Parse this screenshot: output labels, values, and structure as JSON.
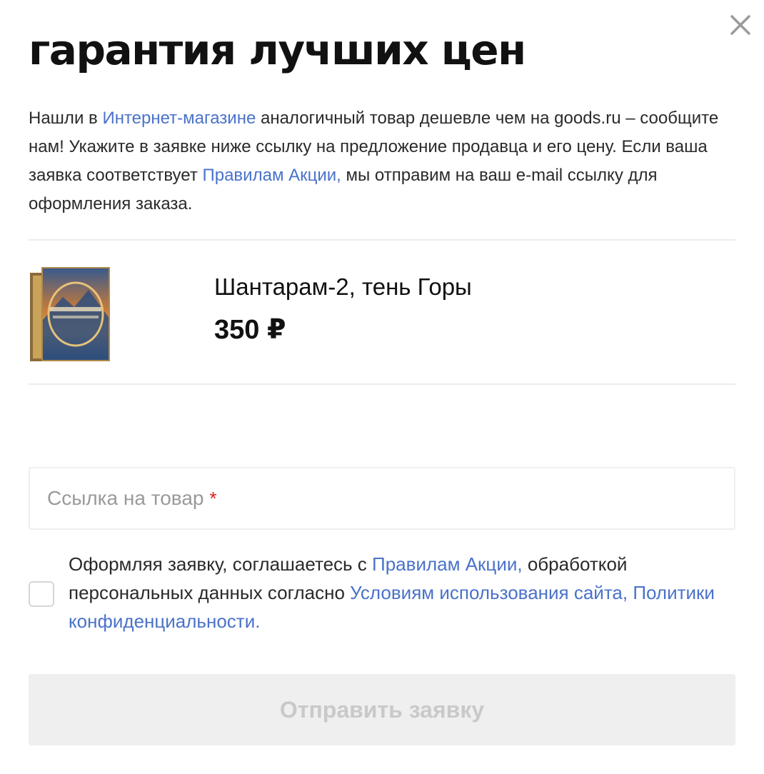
{
  "modal": {
    "title": "гарантия лучших цен",
    "close_icon": "close-icon"
  },
  "intro": {
    "text_1": "Нашли в ",
    "link_shop": "Интернет-магазине",
    "text_2": " аналогичный товар дешевле чем на goods.ru – сообщите нам! Укажите в заявке ниже ссылку на предложение продавца и его цену. Если ваша заявка соответствует ",
    "link_rules": "Правилам Акции,",
    "text_3": " мы отправим на ваш e-mail ссылку для оформления заказа."
  },
  "product": {
    "image_icon": "book-cover-image",
    "title": "Шантарам-2, тень Горы",
    "price": "350 ₽"
  },
  "form": {
    "link_input_label": "Ссылка на товар",
    "required_mark": "*"
  },
  "consent": {
    "text_1": "Оформляя заявку, соглашаетесь с ",
    "link_rules": "Правилам Акции,",
    "text_2": " обработкой персональных данных согласно ",
    "link_terms": "Условиям использования сайта,",
    "text_3": " ",
    "link_privacy": "Политики конфиденциальности."
  },
  "submit": {
    "label": "Отправить заявку"
  },
  "colors": {
    "link": "#4a72c9",
    "required": "#e02020",
    "button_disabled_bg": "#efefef",
    "button_disabled_text": "#c9c9c9"
  }
}
